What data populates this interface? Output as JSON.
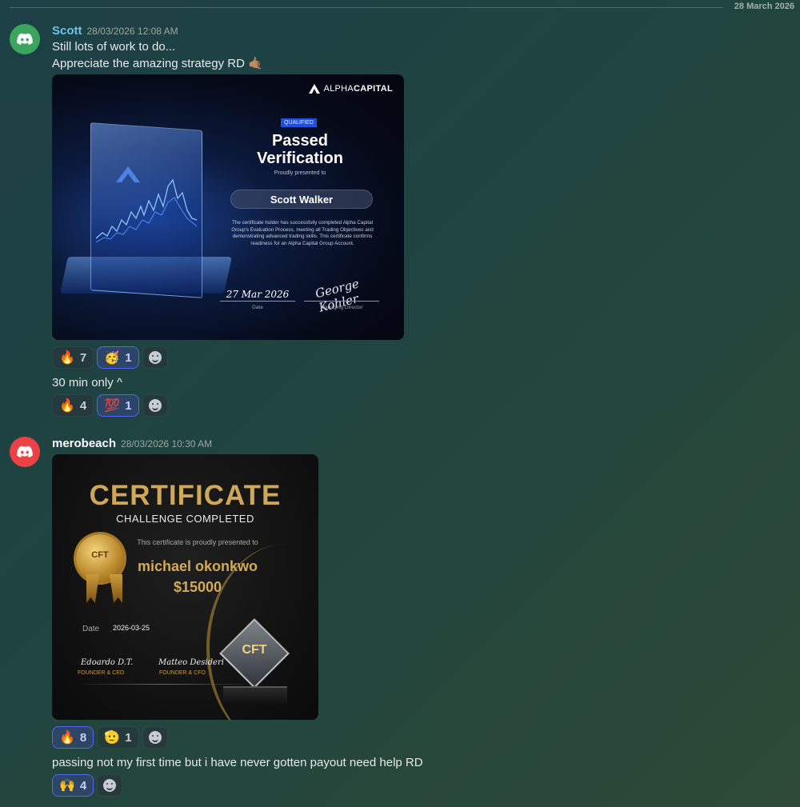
{
  "divider": {
    "date": "28 March 2026"
  },
  "messages": [
    {
      "author": "Scott",
      "author_color": "#6cc5e8",
      "avatar_color": "#3ba55d",
      "timestamp": "28/03/2026 12:08 AM",
      "lines": [
        "Still lots of work to do...",
        "Appreciate the amazing strategy RD 🤙🏽"
      ],
      "certificate": {
        "brand_bold": "ALPHA",
        "brand_light": "CAPITAL",
        "badge": "QUALIFIED",
        "title_line1": "Passed",
        "title_line2": "Verification",
        "presented": "Proudly presented to",
        "name": "Scott Walker",
        "body": "The certificate holder has successfully completed Alpha Capital Group's Evaluation Process, meeting all Trading Objectives and demonstrating advanced trading skills. This certificate confirms readiness for an Alpha Capital Group Account.",
        "date": "27 Mar 2026",
        "date_label": "Date",
        "signature": "George Kohler",
        "signature_label": "Managing Director"
      },
      "reactions": [
        {
          "emoji": "🔥",
          "count": "7"
        },
        {
          "emoji": "🥳",
          "count": "1"
        }
      ]
    },
    {
      "lines": [
        "30 min only ^"
      ],
      "reactions": [
        {
          "emoji": "🔥",
          "count": "4"
        },
        {
          "emoji": "💯",
          "count": "1"
        }
      ]
    },
    {
      "author": "merobeach",
      "author_color": "#ffffff",
      "avatar_color": "#ed4245",
      "timestamp": "28/03/2026 10:30 AM",
      "certificate": {
        "title": "CERTIFICATE",
        "subtitle": "CHALLENGE COMPLETED",
        "presented": "This certificate is proudly presented to",
        "name": "michael okonkwo",
        "amount": "$15000",
        "date_label": "Date",
        "date": "2026-03-25",
        "sig_a": "Edoardo D.T.",
        "role_a": "FOUNDER & CEO",
        "sig_b": "Matteo Desideri",
        "role_b": "FOUNDER & CFO",
        "seal": "CFT"
      },
      "reactions": [
        {
          "emoji": "🔥",
          "count": "8"
        },
        {
          "emoji": "🫡",
          "count": "1"
        }
      ]
    },
    {
      "lines": [
        "passing not my first time but i have never gotten payout need help RD"
      ],
      "reactions": [
        {
          "emoji": "🙌",
          "count": "4"
        }
      ]
    }
  ]
}
